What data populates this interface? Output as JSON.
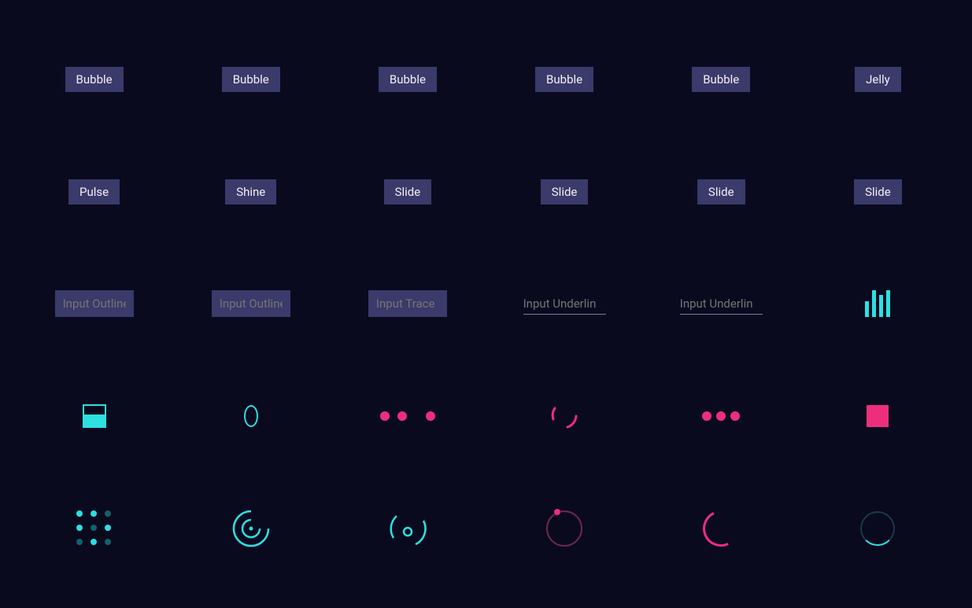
{
  "colors": {
    "bg": "#0a0a1f",
    "buttonBg": "#3a3a6b",
    "text": "#f0f0f5",
    "placeholder": "#b0b0c5",
    "cyan": "#2de0e0",
    "pink": "#ed2e7c"
  },
  "cells": [
    {
      "kind": "button",
      "label": "Bubble",
      "name": "button-bubble-1"
    },
    {
      "kind": "button",
      "label": "Bubble",
      "name": "button-bubble-2"
    },
    {
      "kind": "button",
      "label": "Bubble",
      "name": "button-bubble-3"
    },
    {
      "kind": "button",
      "label": "Bubble",
      "name": "button-bubble-4"
    },
    {
      "kind": "button",
      "label": "Bubble",
      "name": "button-bubble-5"
    },
    {
      "kind": "button",
      "label": "Jelly",
      "name": "button-jelly"
    },
    {
      "kind": "button",
      "label": "Pulse",
      "name": "button-pulse"
    },
    {
      "kind": "button",
      "label": "Shine",
      "name": "button-shine"
    },
    {
      "kind": "button",
      "label": "Slide",
      "name": "button-slide-1"
    },
    {
      "kind": "button",
      "label": "Slide",
      "name": "button-slide-2"
    },
    {
      "kind": "button",
      "label": "Slide",
      "name": "button-slide-3"
    },
    {
      "kind": "button",
      "label": "Slide",
      "name": "button-slide-4"
    },
    {
      "kind": "input-box",
      "placeholder": "Input Outline",
      "name": "input-outline-1"
    },
    {
      "kind": "input-box",
      "placeholder": "Input Outline",
      "name": "input-outline-2"
    },
    {
      "kind": "input-box",
      "placeholder": "Input Trace",
      "name": "input-trace"
    },
    {
      "kind": "input-underline",
      "placeholder": "Input Underlin",
      "name": "input-underline-1"
    },
    {
      "kind": "input-underline",
      "placeholder": "Input Underlin",
      "name": "input-underline-2"
    },
    {
      "kind": "loader-bars",
      "name": "loader-bars"
    },
    {
      "kind": "loader-box-fill",
      "name": "loader-box-fill"
    },
    {
      "kind": "loader-oval",
      "name": "loader-oval"
    },
    {
      "kind": "loader-dots-gap",
      "name": "loader-dots-gap"
    },
    {
      "kind": "loader-arc-broken",
      "name": "loader-arc-broken"
    },
    {
      "kind": "loader-dots-row",
      "name": "loader-dots-row"
    },
    {
      "kind": "loader-square",
      "name": "loader-square"
    },
    {
      "kind": "loader-dot-grid",
      "name": "loader-dot-grid"
    },
    {
      "kind": "loader-nested-arcs",
      "name": "loader-nested-arcs"
    },
    {
      "kind": "loader-orbit",
      "name": "loader-orbit"
    },
    {
      "kind": "loader-ring-dot",
      "name": "loader-ring-dot"
    },
    {
      "kind": "loader-ring-arc-pink",
      "name": "loader-ring-arc-pink"
    },
    {
      "kind": "loader-ring-thin",
      "name": "loader-ring-thin"
    }
  ]
}
